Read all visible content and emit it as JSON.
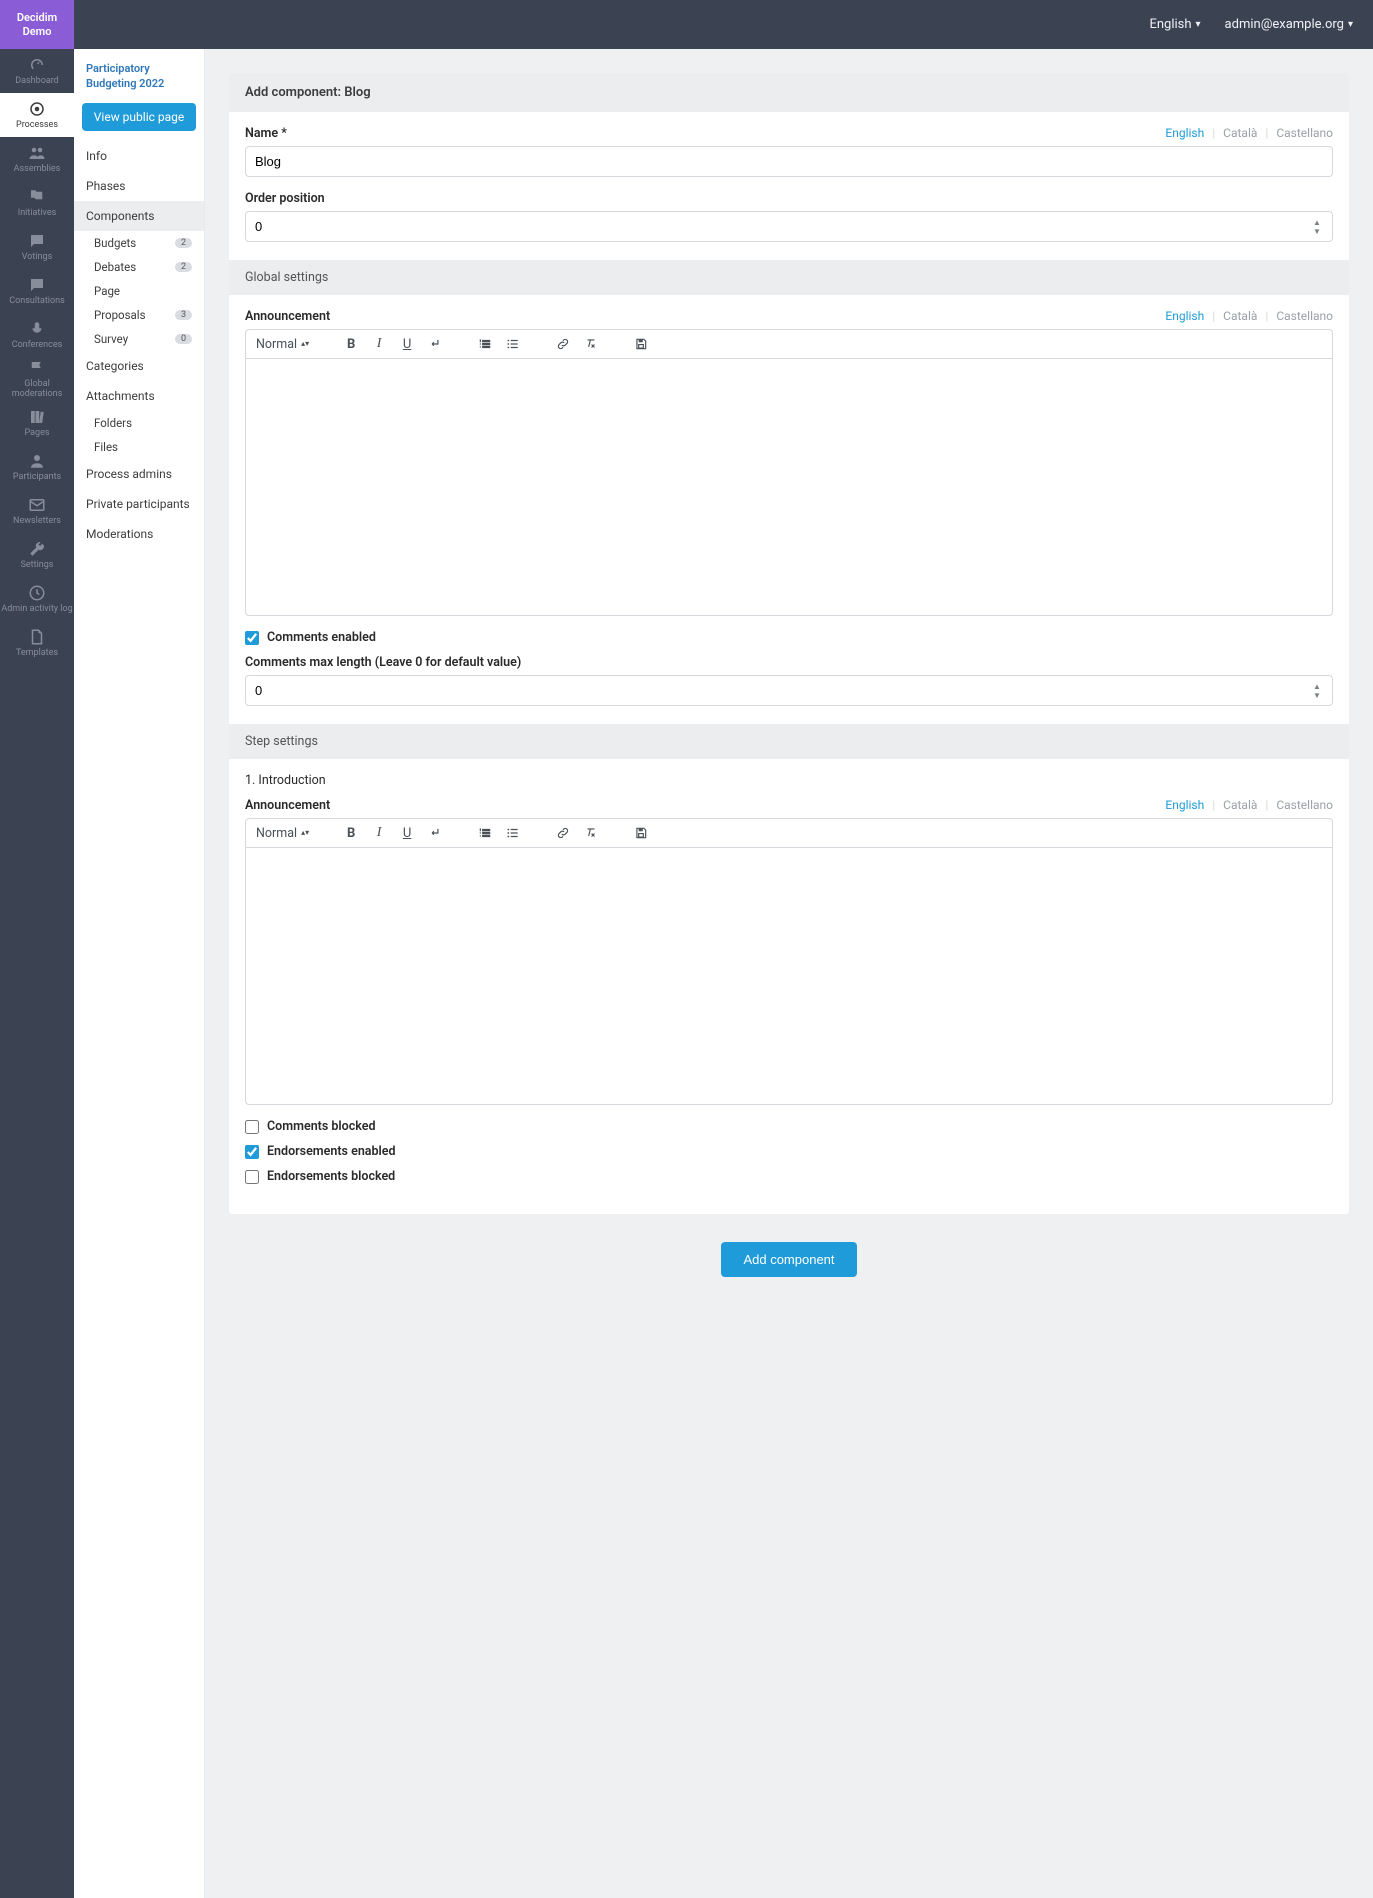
{
  "brand": "Decidim Demo",
  "header": {
    "language": "English",
    "user": "admin@example.org"
  },
  "mainNav": [
    {
      "label": "Dashboard",
      "icon": "gauge"
    },
    {
      "label": "Processes",
      "icon": "target",
      "active": true
    },
    {
      "label": "Assemblies",
      "icon": "users"
    },
    {
      "label": "Initiatives",
      "icon": "flag2"
    },
    {
      "label": "Votings",
      "icon": "chat"
    },
    {
      "label": "Consultations",
      "icon": "chat"
    },
    {
      "label": "Conferences",
      "icon": "mic"
    },
    {
      "label": "Global moderations",
      "icon": "flag"
    },
    {
      "label": "Pages",
      "icon": "books"
    },
    {
      "label": "Participants",
      "icon": "person"
    },
    {
      "label": "Newsletters",
      "icon": "mail"
    },
    {
      "label": "Settings",
      "icon": "wrench"
    },
    {
      "label": "Admin activity log",
      "icon": "clock"
    },
    {
      "label": "Templates",
      "icon": "doc"
    }
  ],
  "secondary": {
    "breadcrumb": "Participatory Budgeting 2022",
    "viewPublic": "View public page",
    "items": [
      {
        "label": "Info"
      },
      {
        "label": "Phases"
      },
      {
        "label": "Components",
        "active": true,
        "sub": [
          {
            "label": "Budgets",
            "badge": "2"
          },
          {
            "label": "Debates",
            "badge": "2"
          },
          {
            "label": "Page"
          },
          {
            "label": "Proposals",
            "badge": "3"
          },
          {
            "label": "Survey",
            "badge": "0"
          }
        ]
      },
      {
        "label": "Categories"
      },
      {
        "label": "Attachments",
        "sub": [
          {
            "label": "Folders"
          },
          {
            "label": "Files"
          }
        ]
      },
      {
        "label": "Process admins"
      },
      {
        "label": "Private participants"
      },
      {
        "label": "Moderations"
      }
    ]
  },
  "langTabs": [
    "English",
    "Català",
    "Castellano"
  ],
  "form": {
    "cardTitle": "Add component: Blog",
    "nameLabel": "Name *",
    "nameValue": "Blog",
    "orderLabel": "Order position",
    "orderValue": "0",
    "globalHeading": "Global settings",
    "announcementLabel": "Announcement",
    "editorFormat": "Normal",
    "commentsEnabled": {
      "label": "Comments enabled",
      "checked": true
    },
    "commentsMaxLabel": "Comments max length (Leave 0 for default value)",
    "commentsMaxValue": "0",
    "stepHeading": "Step settings",
    "stepName": "1. Introduction",
    "commentsBlocked": {
      "label": "Comments blocked",
      "checked": false
    },
    "endorsementsEnabled": {
      "label": "Endorsements enabled",
      "checked": true
    },
    "endorsementsBlocked": {
      "label": "Endorsements blocked",
      "checked": false
    },
    "submit": "Add component"
  }
}
